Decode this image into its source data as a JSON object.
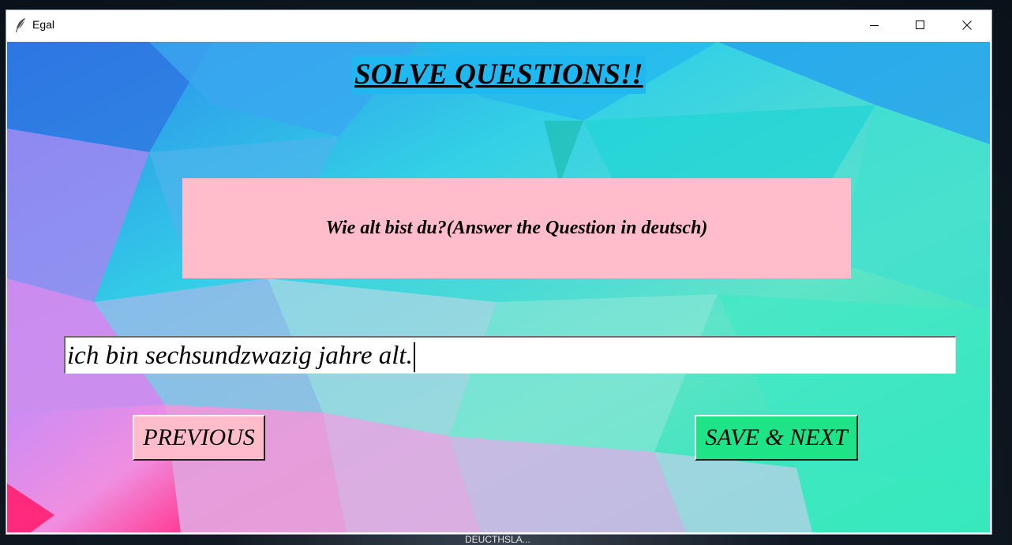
{
  "window": {
    "title": "Egal",
    "icon": "feather-icon",
    "controls": [
      "minimize-icon",
      "maximize-icon",
      "close-icon"
    ]
  },
  "main": {
    "heading": "SOLVE QUESTIONS!!",
    "question": "Wie alt bist du?(Answer the Question in deutsch)",
    "answer_value": "ich bin sechsundzwazig jahre alt.",
    "previous_label": "PREVIOUS",
    "next_label": "SAVE & NEXT"
  },
  "taskbar": {
    "label": "DEUCTHSLA..."
  },
  "colors": {
    "heading_bg": "#1fb8f0",
    "question_bg": "#ffbccb",
    "previous_bg": "#ffbccb",
    "next_bg": "#1ee387"
  }
}
